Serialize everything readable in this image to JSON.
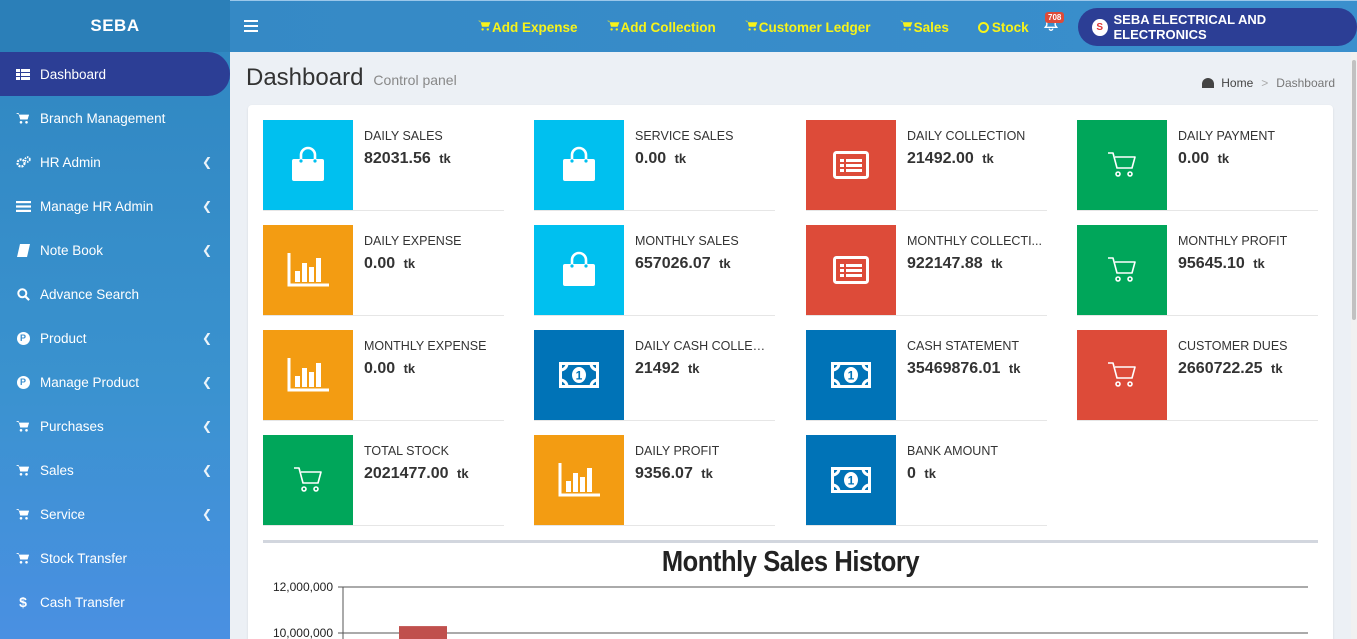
{
  "brand": "SEBA",
  "sidebar": {
    "items": [
      {
        "label": "Dashboard",
        "icon": "grid-icon",
        "active": true,
        "chevron": false
      },
      {
        "label": "Branch Management",
        "icon": "cart-icon",
        "chevron": false
      },
      {
        "label": "HR Admin",
        "icon": "gears-icon",
        "chevron": true
      },
      {
        "label": "Manage HR Admin",
        "icon": "list-icon",
        "chevron": true
      },
      {
        "label": "Note Book",
        "icon": "book-icon",
        "chevron": true
      },
      {
        "label": "Advance Search",
        "icon": "search-icon",
        "chevron": false
      },
      {
        "label": "Product",
        "icon": "product-icon",
        "chevron": true
      },
      {
        "label": "Manage Product",
        "icon": "product-icon",
        "chevron": true
      },
      {
        "label": "Purchases",
        "icon": "cart-icon",
        "chevron": true
      },
      {
        "label": "Sales",
        "icon": "cart-icon",
        "chevron": true
      },
      {
        "label": "Service",
        "icon": "cart-icon",
        "chevron": true
      },
      {
        "label": "Stock Transfer",
        "icon": "cart-icon",
        "chevron": false
      },
      {
        "label": "Cash Transfer",
        "icon": "dollar-icon",
        "chevron": false
      }
    ]
  },
  "topbar": {
    "links": [
      {
        "label": "Add Expense",
        "icon": "cart-icon"
      },
      {
        "label": "Add Collection",
        "icon": "cart-icon"
      },
      {
        "label": "Customer Ledger",
        "icon": "cart-icon"
      },
      {
        "label": "Sales",
        "icon": "cart-icon"
      },
      {
        "label": "Stock",
        "icon": "circle-icon"
      }
    ],
    "notification_count": "708",
    "company": "SEBA ELECTRICAL AND ELECTRONICS"
  },
  "header": {
    "title": "Dashboard",
    "subtitle": "Control panel",
    "breadcrumb_home": "Home",
    "breadcrumb_sep": ">",
    "breadcrumb_current": "Dashboard"
  },
  "stats": [
    {
      "label": "DAILY SALES",
      "value": "82031.56",
      "unit": "tk",
      "color": "#00c0ef",
      "icon": "shopping-bag-icon"
    },
    {
      "label": "SERVICE SALES",
      "value": "0.00",
      "unit": "tk",
      "color": "#00c0ef",
      "icon": "shopping-bag-icon"
    },
    {
      "label": "DAILY COLLECTION",
      "value": "21492.00",
      "unit": "tk",
      "color": "#dd4b39",
      "icon": "list-alt-icon"
    },
    {
      "label": "DAILY PAYMENT",
      "value": "0.00",
      "unit": "tk",
      "color": "#00a65a",
      "icon": "cart-icon"
    },
    {
      "label": "DAILY EXPENSE",
      "value": "0.00",
      "unit": "tk",
      "color": "#f39c12",
      "icon": "bar-chart-icon"
    },
    {
      "label": "MONTHLY SALES",
      "value": "657026.07",
      "unit": "tk",
      "color": "#00c0ef",
      "icon": "shopping-bag-icon"
    },
    {
      "label": "MONTHLY COLLECTI...",
      "value": "922147.88",
      "unit": "tk",
      "color": "#dd4b39",
      "icon": "list-alt-icon"
    },
    {
      "label": "MONTHLY PROFIT",
      "value": "95645.10",
      "unit": "tk",
      "color": "#00a65a",
      "icon": "cart-icon"
    },
    {
      "label": "MONTHLY EXPENSE",
      "value": "0.00",
      "unit": "tk",
      "color": "#f39c12",
      "icon": "bar-chart-icon"
    },
    {
      "label": "DAILY CASH COLLEC...",
      "value": "21492",
      "unit": "tk",
      "color": "#0073b7",
      "icon": "money-icon"
    },
    {
      "label": "CASH STATEMENT",
      "value": "35469876.01",
      "unit": "tk",
      "color": "#0073b7",
      "icon": "money-icon"
    },
    {
      "label": "CUSTOMER DUES",
      "value": "2660722.25",
      "unit": "tk",
      "color": "#dd4b39",
      "icon": "cart-icon"
    },
    {
      "label": "TOTAL STOCK",
      "value": "2021477.00",
      "unit": "tk",
      "color": "#00a65a",
      "icon": "cart-icon"
    },
    {
      "label": "DAILY PROFIT",
      "value": "9356.07",
      "unit": "tk",
      "color": "#f39c12",
      "icon": "bar-chart-icon"
    },
    {
      "label": "BANK AMOUNT",
      "value": "0",
      "unit": "tk",
      "color": "#0073b7",
      "icon": "money-icon"
    }
  ],
  "chart_data": {
    "type": "bar",
    "title": "Monthly Sales History",
    "y_ticks": [
      "12,000,000",
      "10,000,000"
    ],
    "ylim_visible": [
      10000000,
      12000000
    ],
    "series": [
      {
        "values": [
          10300000
        ],
        "color": "#c0504d"
      }
    ]
  }
}
